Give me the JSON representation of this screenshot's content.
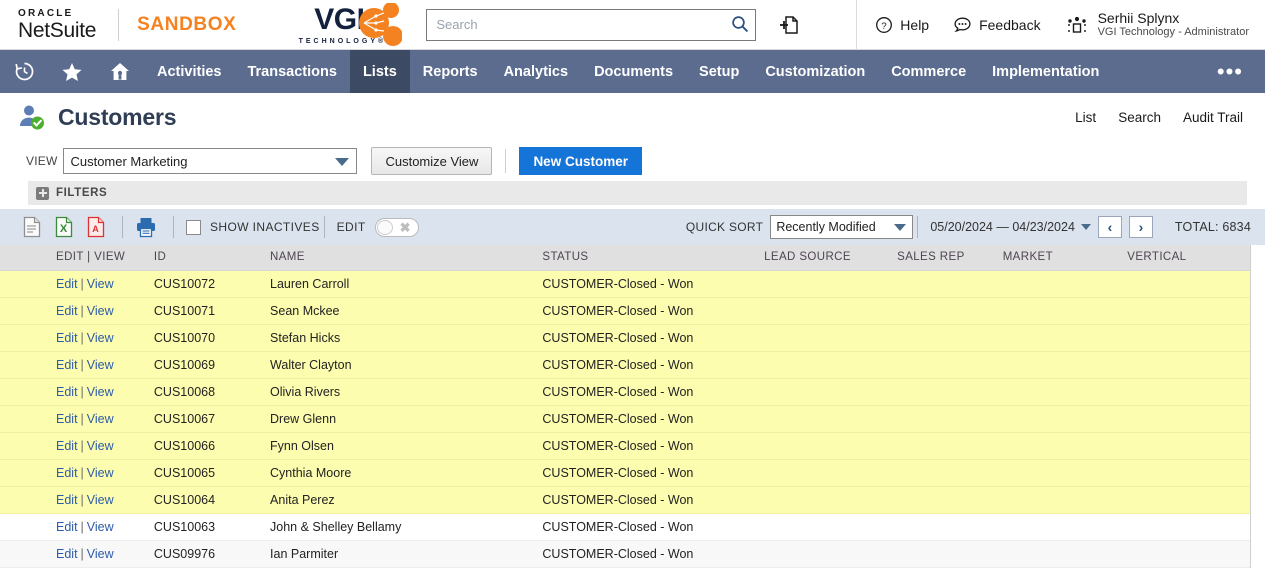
{
  "header": {
    "oracle_word": "ORACLE",
    "netsuite_word": "NetSuite",
    "sandbox_label": "SANDBOX",
    "vgi_text": "VGI",
    "vgi_tagline": "TECHNOLOGY®",
    "search_placeholder": "Search",
    "search_value": "",
    "help_label": "Help",
    "feedback_label": "Feedback",
    "user_name": "Serhii Splynx",
    "user_role": "VGI Technology - Administrator"
  },
  "nav": {
    "items": [
      {
        "label": "Activities",
        "active": false
      },
      {
        "label": "Transactions",
        "active": false
      },
      {
        "label": "Lists",
        "active": true
      },
      {
        "label": "Reports",
        "active": false
      },
      {
        "label": "Analytics",
        "active": false
      },
      {
        "label": "Documents",
        "active": false
      },
      {
        "label": "Setup",
        "active": false
      },
      {
        "label": "Customization",
        "active": false
      },
      {
        "label": "Commerce",
        "active": false
      },
      {
        "label": "Implementation",
        "active": false
      }
    ],
    "overflow_label": "•••"
  },
  "page": {
    "title": "Customers",
    "links": [
      "List",
      "Search",
      "Audit Trail"
    ],
    "view_label": "VIEW",
    "view_value": "Customer Marketing",
    "customize_view_label": "Customize View",
    "new_customer_label": "New Customer",
    "filters_label": "FILTERS"
  },
  "toolbar": {
    "show_inactives_label": "SHOW INACTIVES",
    "show_inactives_checked": false,
    "edit_label": "EDIT",
    "edit_toggle_on": false,
    "quick_sort_label": "QUICK SORT",
    "quick_sort_value": "Recently Modified",
    "date_range": "05/20/2024 — 04/23/2024",
    "prev_label": "‹",
    "next_label": "›",
    "total_label": "TOTAL: 6834"
  },
  "table": {
    "columns": [
      "EDIT | VIEW",
      "ID",
      "NAME",
      "STATUS",
      "LEAD SOURCE",
      "SALES REP",
      "MARKET",
      "VERTICAL"
    ],
    "edit_label": "Edit",
    "view_label": "View",
    "rows": [
      {
        "id": "CUS10072",
        "name": "Lauren Carroll",
        "status": "CUSTOMER-Closed - Won",
        "lead_source": "",
        "sales_rep": "",
        "market": "",
        "vertical": "",
        "style": "hl"
      },
      {
        "id": "CUS10071",
        "name": "Sean Mckee",
        "status": "CUSTOMER-Closed - Won",
        "lead_source": "",
        "sales_rep": "",
        "market": "",
        "vertical": "",
        "style": "hl"
      },
      {
        "id": "CUS10070",
        "name": "Stefan Hicks",
        "status": "CUSTOMER-Closed - Won",
        "lead_source": "",
        "sales_rep": "",
        "market": "",
        "vertical": "",
        "style": "hl"
      },
      {
        "id": "CUS10069",
        "name": "Walter Clayton",
        "status": "CUSTOMER-Closed - Won",
        "lead_source": "",
        "sales_rep": "",
        "market": "",
        "vertical": "",
        "style": "hl"
      },
      {
        "id": "CUS10068",
        "name": "Olivia Rivers",
        "status": "CUSTOMER-Closed - Won",
        "lead_source": "",
        "sales_rep": "",
        "market": "",
        "vertical": "",
        "style": "hl"
      },
      {
        "id": "CUS10067",
        "name": "Drew Glenn",
        "status": "CUSTOMER-Closed - Won",
        "lead_source": "",
        "sales_rep": "",
        "market": "",
        "vertical": "",
        "style": "hl"
      },
      {
        "id": "CUS10066",
        "name": "Fynn Olsen",
        "status": "CUSTOMER-Closed - Won",
        "lead_source": "",
        "sales_rep": "",
        "market": "",
        "vertical": "",
        "style": "hl"
      },
      {
        "id": "CUS10065",
        "name": "Cynthia Moore",
        "status": "CUSTOMER-Closed - Won",
        "lead_source": "",
        "sales_rep": "",
        "market": "",
        "vertical": "",
        "style": "hl"
      },
      {
        "id": "CUS10064",
        "name": "Anita Perez",
        "status": "CUSTOMER-Closed - Won",
        "lead_source": "",
        "sales_rep": "",
        "market": "",
        "vertical": "",
        "style": "hl"
      },
      {
        "id": "CUS10063",
        "name": "John & Shelley Bellamy",
        "status": "CUSTOMER-Closed - Won",
        "lead_source": "",
        "sales_rep": "",
        "market": "",
        "vertical": "",
        "style": "plain"
      },
      {
        "id": "CUS09976",
        "name": "Ian Parmiter",
        "status": "CUSTOMER-Closed - Won",
        "lead_source": "",
        "sales_rep": "",
        "market": "",
        "vertical": "",
        "style": "alt"
      }
    ]
  },
  "colors": {
    "nav_bg": "#5c6c8f",
    "nav_active": "#3c4a63",
    "sandbox_orange": "#f58220",
    "primary_blue": "#1574d8",
    "toolbar_bg": "#dbe3ee",
    "row_highlight": "#fdfdaf",
    "link_blue": "#2d5ca8"
  }
}
